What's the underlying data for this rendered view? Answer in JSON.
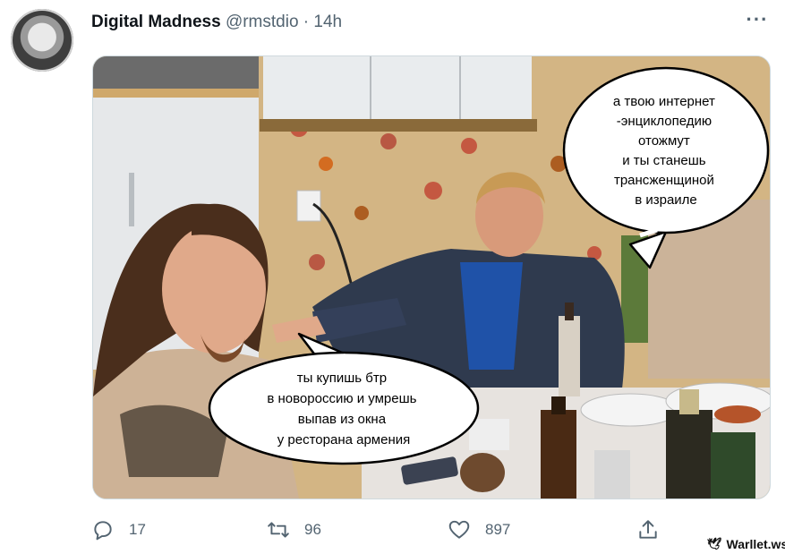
{
  "tweet": {
    "author_name": "Digital Madness",
    "author_handle": "@rmstdio",
    "separator": "·",
    "time": "14h",
    "more_icon": "more-icon"
  },
  "media": {
    "bubble_right": [
      "а твою интернет",
      "-энциклопедию",
      "отожмут",
      "и ты станешь",
      "трансженщиной",
      "в израиле"
    ],
    "bubble_left": [
      "ты купишь бтр",
      "в новороссию и умрешь",
      "выпав из окна",
      "у ресторана армения"
    ]
  },
  "actions": {
    "reply_count": "17",
    "retweet_count": "96",
    "like_count": "897",
    "share_icon": "share-icon"
  },
  "watermark": {
    "text": "Warllet.ws"
  }
}
